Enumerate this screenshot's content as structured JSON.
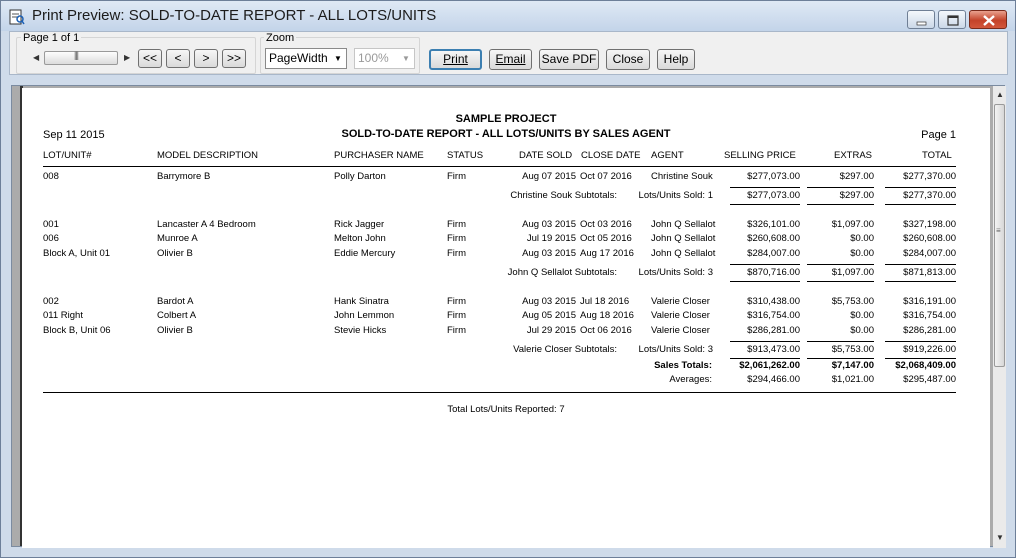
{
  "window": {
    "title": "Print Preview: SOLD-TO-DATE REPORT - ALL LOTS/UNITS"
  },
  "toolbar": {
    "page_label": "Page 1 of 1",
    "zoom_label": "Zoom",
    "nav": [
      "<<",
      "<",
      ">",
      ">>"
    ],
    "zoom_mode": "PageWidth",
    "zoom_percent": "100%",
    "buttons": {
      "print": "Print",
      "email": "Email",
      "save_pdf": "Save PDF",
      "close": "Close",
      "help": "Help"
    }
  },
  "report": {
    "project": "SAMPLE PROJECT",
    "title": "SOLD-TO-DATE REPORT - ALL LOTS/UNITS BY SALES AGENT",
    "date": "Sep 11 2015",
    "page": "Page 1",
    "columns": [
      "LOT/UNIT#",
      "MODEL DESCRIPTION",
      "PURCHASER NAME",
      "STATUS",
      "DATE SOLD",
      "CLOSE DATE",
      "AGENT",
      "SELLING PRICE",
      "EXTRAS",
      "TOTAL"
    ],
    "groups": [
      {
        "rows": [
          [
            "008",
            "Barrymore B",
            "Polly Darton",
            "Firm",
            "Aug 07 2015",
            "Oct 07 2016",
            "Christine Souk",
            "$277,073.00",
            "$297.00",
            "$277,370.00"
          ]
        ],
        "subtotal": {
          "label": "Christine Souk Subtotals:",
          "sold": "Lots/Units Sold: 1",
          "price": "$277,073.00",
          "extras": "$297.00",
          "total": "$277,370.00"
        }
      },
      {
        "rows": [
          [
            "001",
            "Lancaster A 4 Bedroom",
            "Rick Jagger",
            "Firm",
            "Aug 03 2015",
            "Oct 03 2016",
            "John Q Sellalot",
            "$326,101.00",
            "$1,097.00",
            "$327,198.00"
          ],
          [
            "006",
            "Munroe A",
            "Melton John",
            "Firm",
            "Jul 19 2015",
            "Oct 05 2016",
            "John Q Sellalot",
            "$260,608.00",
            "$0.00",
            "$260,608.00"
          ],
          [
            "Block A, Unit 01",
            "Olivier B",
            "Eddie Mercury",
            "Firm",
            "Aug 03 2015",
            "Aug 17 2016",
            "John Q Sellalot",
            "$284,007.00",
            "$0.00",
            "$284,007.00"
          ]
        ],
        "subtotal": {
          "label": "John Q Sellalot Subtotals:",
          "sold": "Lots/Units Sold: 3",
          "price": "$870,716.00",
          "extras": "$1,097.00",
          "total": "$871,813.00"
        }
      },
      {
        "rows": [
          [
            "002",
            "Bardot A",
            "Hank Sinatra",
            "Firm",
            "Aug 03 2015",
            "Jul 18 2016",
            "Valerie Closer",
            "$310,438.00",
            "$5,753.00",
            "$316,191.00"
          ],
          [
            "011 Right",
            "Colbert A",
            "John Lemmon",
            "Firm",
            "Aug 05 2015",
            "Aug 18 2016",
            "Valerie Closer",
            "$316,754.00",
            "$0.00",
            "$316,754.00"
          ],
          [
            "Block B, Unit 06",
            "Olivier B",
            "Stevie Hicks",
            "Firm",
            "Jul 29 2015",
            "Oct 06 2016",
            "Valerie Closer",
            "$286,281.00",
            "$0.00",
            "$286,281.00"
          ]
        ],
        "subtotal": {
          "label": "Valerie Closer Subtotals:",
          "sold": "Lots/Units Sold: 3",
          "price": "$913,473.00",
          "extras": "$5,753.00",
          "total": "$919,226.00"
        }
      }
    ],
    "sales_totals": {
      "label": "Sales Totals:",
      "price": "$2,061,262.00",
      "extras": "$7,147.00",
      "total": "$2,068,409.00"
    },
    "averages": {
      "label": "Averages:",
      "price": "$294,466.00",
      "extras": "$1,021.00",
      "total": "$295,487.00"
    },
    "footer": "Total Lots/Units Reported: 7"
  }
}
